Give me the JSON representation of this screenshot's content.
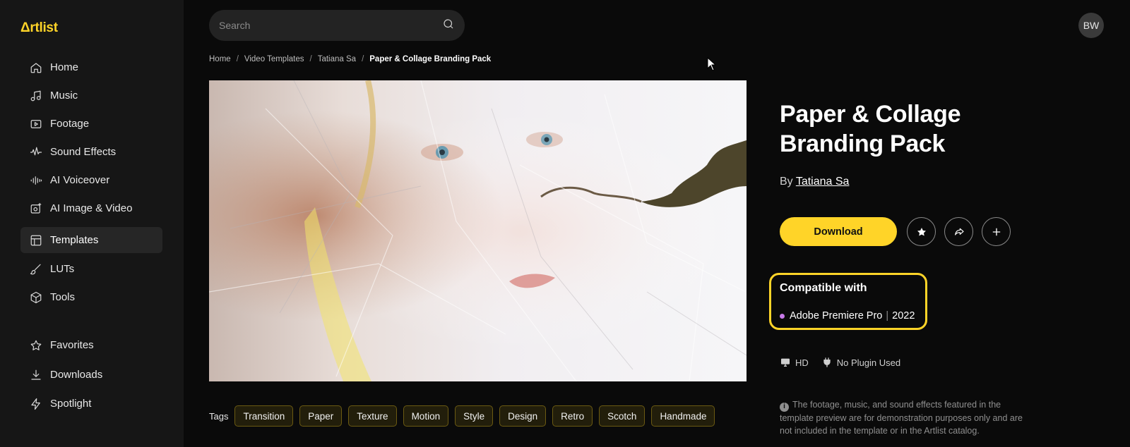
{
  "brand": {
    "logo": "Δrtlist",
    "accent": "#ffd428"
  },
  "sidebar": {
    "items": [
      {
        "label": "Home",
        "icon": "home-icon"
      },
      {
        "label": "Music",
        "icon": "music-note-icon"
      },
      {
        "label": "Footage",
        "icon": "video-icon"
      },
      {
        "label": "Sound Effects",
        "icon": "waveform-icon"
      },
      {
        "label": "AI Voiceover",
        "icon": "voice-bars-icon"
      },
      {
        "label": "AI Image & Video",
        "icon": "ai-image-icon"
      },
      {
        "label": "Templates",
        "icon": "template-icon",
        "active": true
      },
      {
        "label": "LUTs",
        "icon": "brush-icon"
      },
      {
        "label": "Tools",
        "icon": "cube-icon"
      }
    ],
    "secondary": [
      {
        "label": "Favorites",
        "icon": "star-icon"
      },
      {
        "label": "Downloads",
        "icon": "download-icon"
      },
      {
        "label": "Spotlight",
        "icon": "bolt-icon"
      }
    ]
  },
  "header": {
    "search_placeholder": "Search",
    "avatar_initials": "BW"
  },
  "breadcrumb": [
    "Home",
    "Video Templates",
    "Tatiana Sa",
    "Paper & Collage Branding Pack"
  ],
  "product": {
    "title": "Paper & Collage Branding Pack",
    "by_label": "By",
    "author": "Tatiana Sa",
    "download_label": "Download",
    "compatible_title": "Compatible with",
    "compatible_app": "Adobe Premiere Pro",
    "compatible_version": "2022",
    "compatible_dot_color": "#c779e8",
    "spec_resolution": "HD",
    "spec_plugin": "No Plugin Used",
    "notice": "The footage, music, and sound effects featured in the template preview are for demonstration purposes only and are not included in the template or in the Artlist catalog."
  },
  "tags": {
    "label": "Tags",
    "items": [
      "Transition",
      "Paper",
      "Texture",
      "Motion",
      "Style",
      "Design",
      "Retro",
      "Scotch",
      "Handmade"
    ]
  }
}
